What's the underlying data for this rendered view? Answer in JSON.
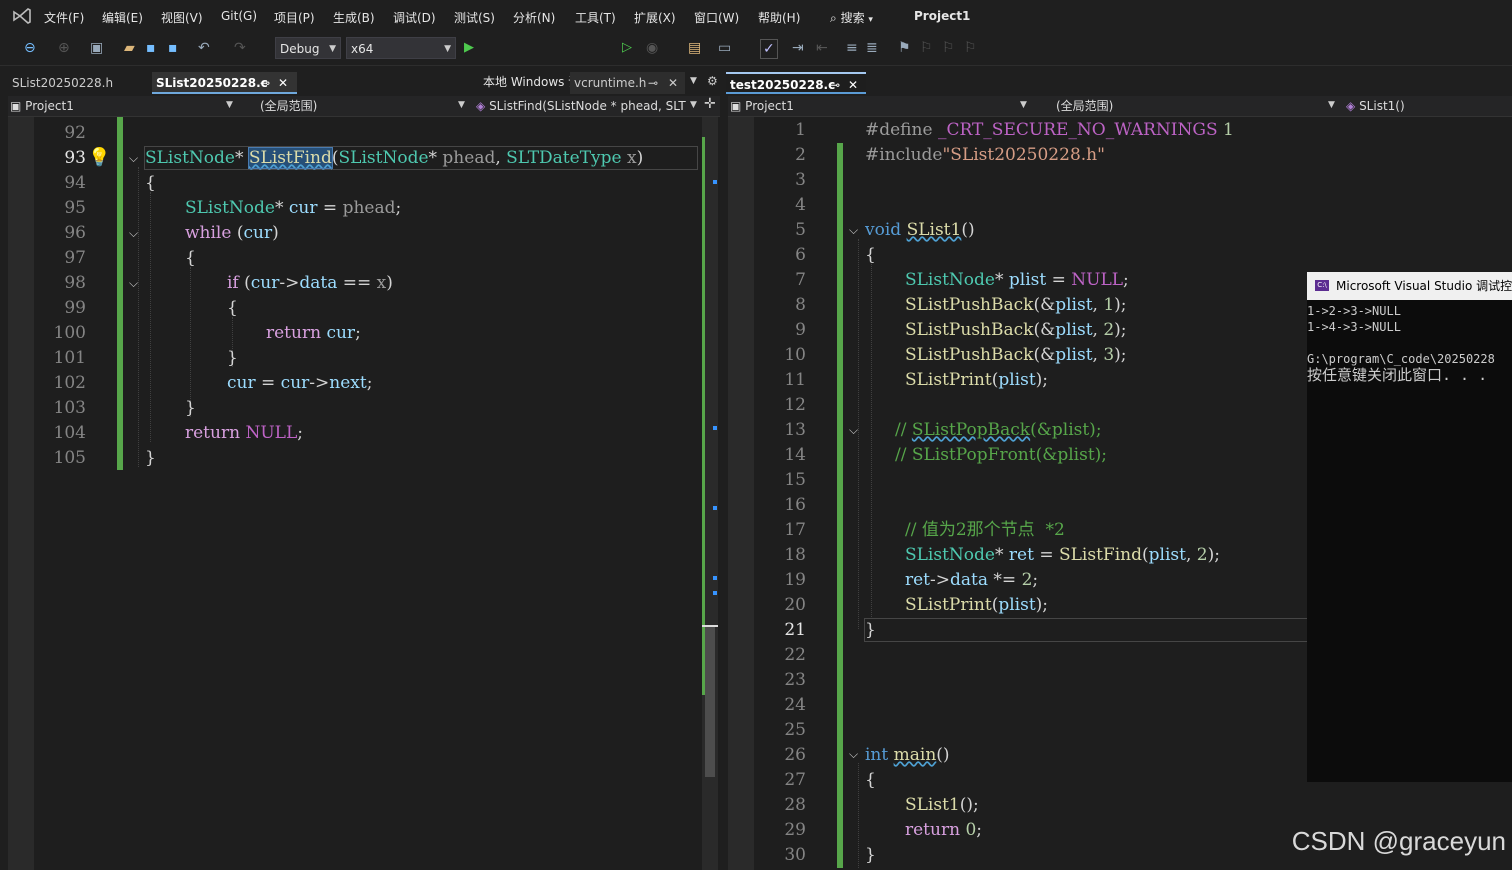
{
  "menu": [
    "文件(F)",
    "编辑(E)",
    "视图(V)",
    "Git(G)",
    "项目(P)",
    "生成(B)",
    "调试(D)",
    "测试(S)",
    "分析(N)",
    "工具(T)",
    "扩展(X)",
    "窗口(W)",
    "帮助(H)"
  ],
  "search_label": "搜索",
  "solution_name": "Project1",
  "toolbar": {
    "config": "Debug",
    "platform": "x64",
    "run_label": "本地 Windows 调试器"
  },
  "left_pane": {
    "tabs": [
      "SList20250228.h",
      "SList20250228.c",
      "vcruntime.h"
    ],
    "nav": {
      "project": "Project1",
      "scope": "(全局范围)",
      "member": "SListFind(SListNode * phead, SLTI"
    },
    "line_numbers": [
      "92",
      "93",
      "94",
      "95",
      "96",
      "97",
      "98",
      "99",
      "100",
      "101",
      "102",
      "103",
      "104",
      "105"
    ]
  },
  "right_pane": {
    "tab": "test20250228.c",
    "nav": {
      "project": "Project1",
      "scope": "(全局范围)",
      "member": "SList1()"
    },
    "line_numbers": [
      "1",
      "2",
      "3",
      "4",
      "5",
      "6",
      "7",
      "8",
      "9",
      "10",
      "11",
      "12",
      "13",
      "14",
      "15",
      "16",
      "17",
      "18",
      "19",
      "20",
      "21",
      "22",
      "23",
      "24",
      "25",
      "26",
      "27",
      "28",
      "29",
      "30"
    ],
    "current_line": "21"
  },
  "console": {
    "title": "Microsoft Visual Studio 调试控",
    "lines": [
      "1->2->3->NULL",
      "1->4->3->NULL",
      "",
      "G:\\program\\C_code\\20250228",
      "按任意键关闭此窗口. . ."
    ]
  },
  "watermark": "CSDN @graceyun"
}
